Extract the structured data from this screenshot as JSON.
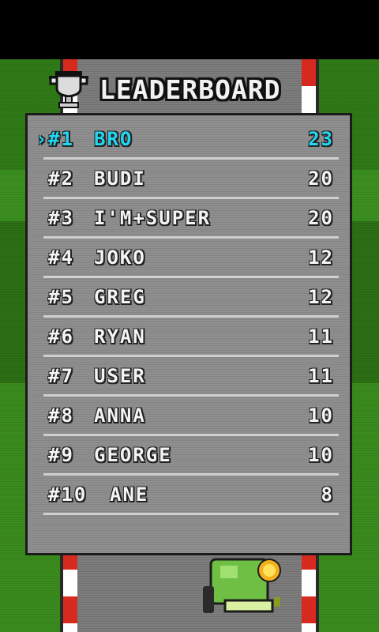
{
  "title": "LEADERBOARD",
  "colors": {
    "highlight": "#22d6f2",
    "panel": "#8f8f8f",
    "grass": "#2f7a17",
    "curb_red": "#d62a1f"
  },
  "highlight_marker": "›",
  "entries": [
    {
      "rank": "#1",
      "name": "BRO",
      "score": "23",
      "highlight": true
    },
    {
      "rank": "#2",
      "name": "BUDI",
      "score": "20"
    },
    {
      "rank": "#3",
      "name": "I'M+SUPER",
      "score": "20"
    },
    {
      "rank": "#4",
      "name": "JOKO",
      "score": "12"
    },
    {
      "rank": "#5",
      "name": "GREG",
      "score": "12"
    },
    {
      "rank": "#6",
      "name": "RYAN",
      "score": "11"
    },
    {
      "rank": "#7",
      "name": "USER",
      "score": "11"
    },
    {
      "rank": "#8",
      "name": "ANNA",
      "score": "10"
    },
    {
      "rank": "#9",
      "name": "GEORGE",
      "score": "10"
    },
    {
      "rank": "#10",
      "name": "ANE",
      "score": "8"
    }
  ]
}
